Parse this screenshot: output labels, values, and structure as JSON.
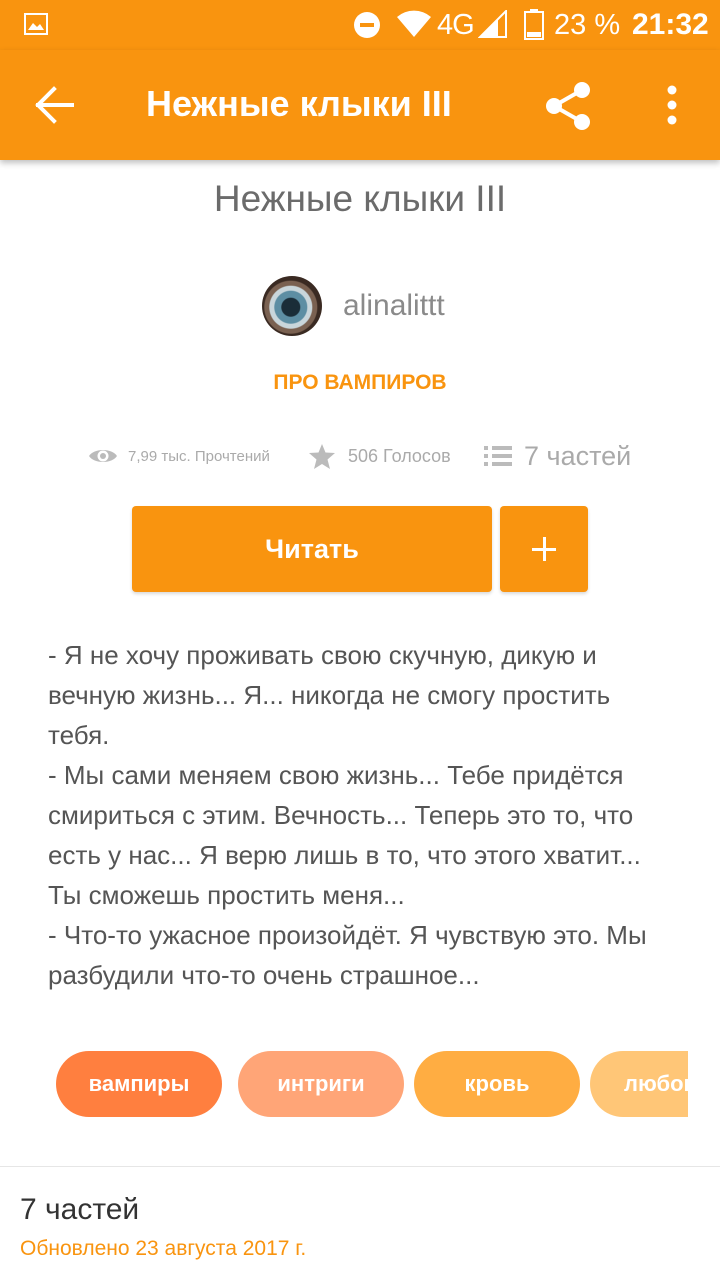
{
  "status_bar": {
    "network": "4G",
    "battery_percent": "23 %",
    "time": "21:32",
    "icons": [
      "image-notification-icon",
      "do-not-disturb-icon",
      "wifi-icon",
      "signal-icon",
      "battery-icon"
    ]
  },
  "app_bar": {
    "title": "Нежные клыки III",
    "background": "#f9940f",
    "icons": [
      "back-arrow-icon",
      "share-icon",
      "more-vert-icon"
    ]
  },
  "story": {
    "title": "Нежные клыки III",
    "author": "alinalittt",
    "category": "ПРО ВАМПИРОВ",
    "stats": {
      "reads": "7,99 тыс. Прочтений",
      "votes": "506 Голосов",
      "parts": "7 частей"
    },
    "description": "- Я не хочу проживать свою скучную, дикую и вечную жизнь... Я... никогда не смогу простить тебя.\n- Мы сами меняем свою жизнь... Тебе придётся смириться с этим. Вечность... Теперь это то, что есть у нас... Я верю лишь в то, что этого хватит... Ты сможешь простить меня...\n- Что-то ужасное произойдёт. Я чувствую это. Мы разбудили что-то очень страшное..."
  },
  "actions": {
    "read_label": "Читать",
    "add_icon": "plus-icon"
  },
  "tags": [
    {
      "label": "вампиры",
      "color": "#ff7f3f"
    },
    {
      "label": "интриги",
      "color": "#ffa577"
    },
    {
      "label": "кровь",
      "color": "#ffad42"
    },
    {
      "label": "любовь",
      "color": "#ffc677"
    }
  ],
  "parts_section": {
    "title": "7 частей",
    "updated": "Обновлено 23 августа 2017 г."
  },
  "colors": {
    "accent": "#f9940f",
    "text_primary": "#333333",
    "text_secondary": "#8a8a8a"
  }
}
